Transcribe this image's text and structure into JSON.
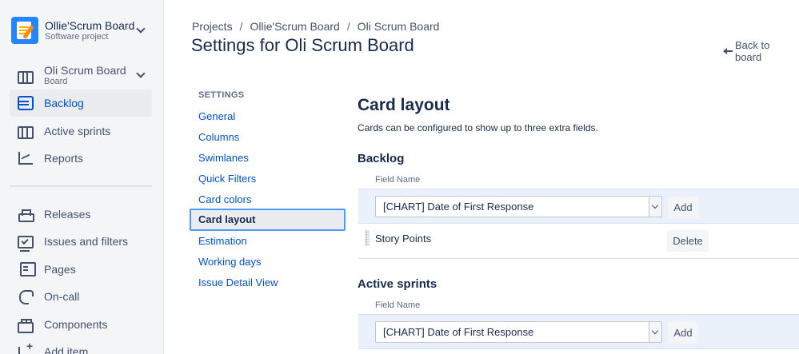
{
  "sidebar": {
    "project_title": "Ollie'Scrum Board",
    "project_sub": "Software project",
    "board_title": "Oli Scrum Board",
    "board_sub": "Board",
    "items": [
      {
        "label": "Backlog"
      },
      {
        "label": "Active sprints"
      },
      {
        "label": "Reports"
      },
      {
        "label": "Releases"
      },
      {
        "label": "Issues and filters"
      },
      {
        "label": "Pages"
      },
      {
        "label": "On-call"
      },
      {
        "label": "Components"
      },
      {
        "label": "Add item"
      }
    ]
  },
  "header": {
    "breadcrumbs": [
      "Projects",
      "Ollie'Scrum Board",
      "Oli Scrum Board"
    ],
    "separator": "/",
    "title": "Settings for Oli Scrum Board",
    "back_link": "Back to board"
  },
  "settings_nav": {
    "heading": "SETTINGS",
    "items": [
      "General",
      "Columns",
      "Swimlanes",
      "Quick Filters",
      "Card colors",
      "Card layout",
      "Estimation",
      "Working days",
      "Issue Detail View"
    ],
    "selected": "Card layout"
  },
  "main": {
    "title": "Card layout",
    "description": "Cards can be configured to show up to three extra fields.",
    "backlog": {
      "title": "Backlog",
      "field_label": "Field Name",
      "select_value": "[CHART] Date of First Response",
      "add_label": "Add",
      "fields": [
        {
          "name": "Story Points",
          "action": "Delete"
        }
      ]
    },
    "active_sprints": {
      "title": "Active sprints",
      "field_label": "Field Name",
      "select_value": "[CHART] Date of First Response",
      "add_label": "Add"
    }
  },
  "colors": {
    "accent": "#0052cc",
    "selected_border": "#4c9aff",
    "row_highlight": "#eaf1fb",
    "sidebar_bg": "#f4f5f7"
  }
}
